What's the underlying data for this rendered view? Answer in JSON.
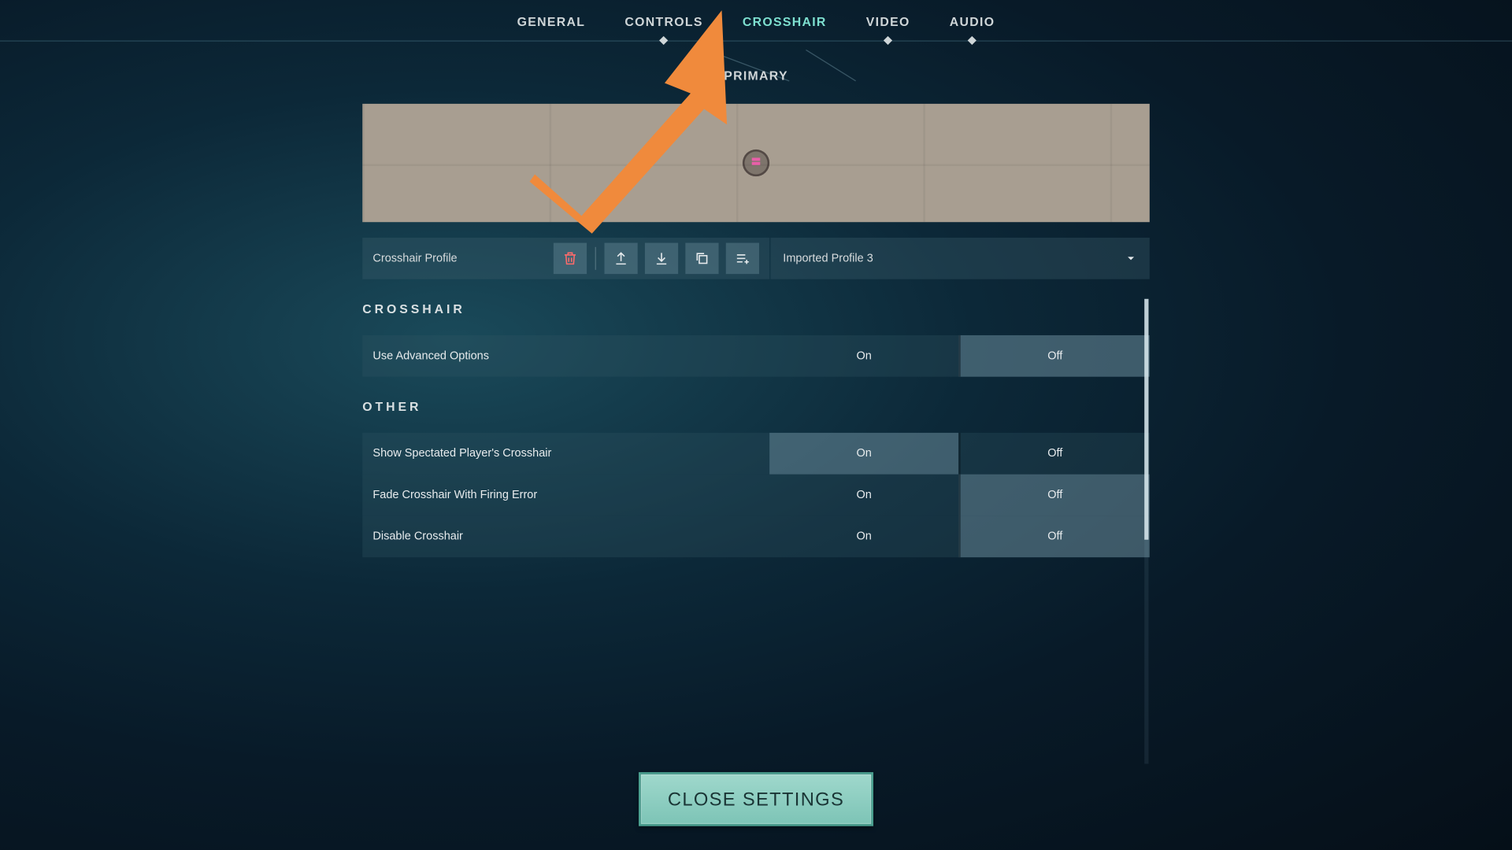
{
  "nav": {
    "tabs": [
      "GENERAL",
      "CONTROLS",
      "CROSSHAIR",
      "VIDEO",
      "AUDIO"
    ],
    "active_index": 2
  },
  "subtab": {
    "label": "PRIMARY"
  },
  "profile": {
    "label": "Crosshair Profile",
    "selected": "Imported Profile 3",
    "icons": [
      "delete",
      "export",
      "import",
      "copy",
      "create-new"
    ]
  },
  "sections": [
    {
      "title": "CROSSHAIR",
      "rows": [
        {
          "label": "Use Advanced Options",
          "options": [
            "On",
            "Off"
          ],
          "selected": 1
        }
      ]
    },
    {
      "title": "OTHER",
      "rows": [
        {
          "label": "Show Spectated Player's Crosshair",
          "options": [
            "On",
            "Off"
          ],
          "selected": 0
        },
        {
          "label": "Fade Crosshair With Firing Error",
          "options": [
            "On",
            "Off"
          ],
          "selected": 1
        },
        {
          "label": "Disable Crosshair",
          "options": [
            "On",
            "Off"
          ],
          "selected": 1
        }
      ]
    }
  ],
  "close_button": "CLOSE SETTINGS",
  "annotation": {
    "type": "arrow",
    "color": "#f08a3c",
    "points_to": "tab-crosshair"
  }
}
